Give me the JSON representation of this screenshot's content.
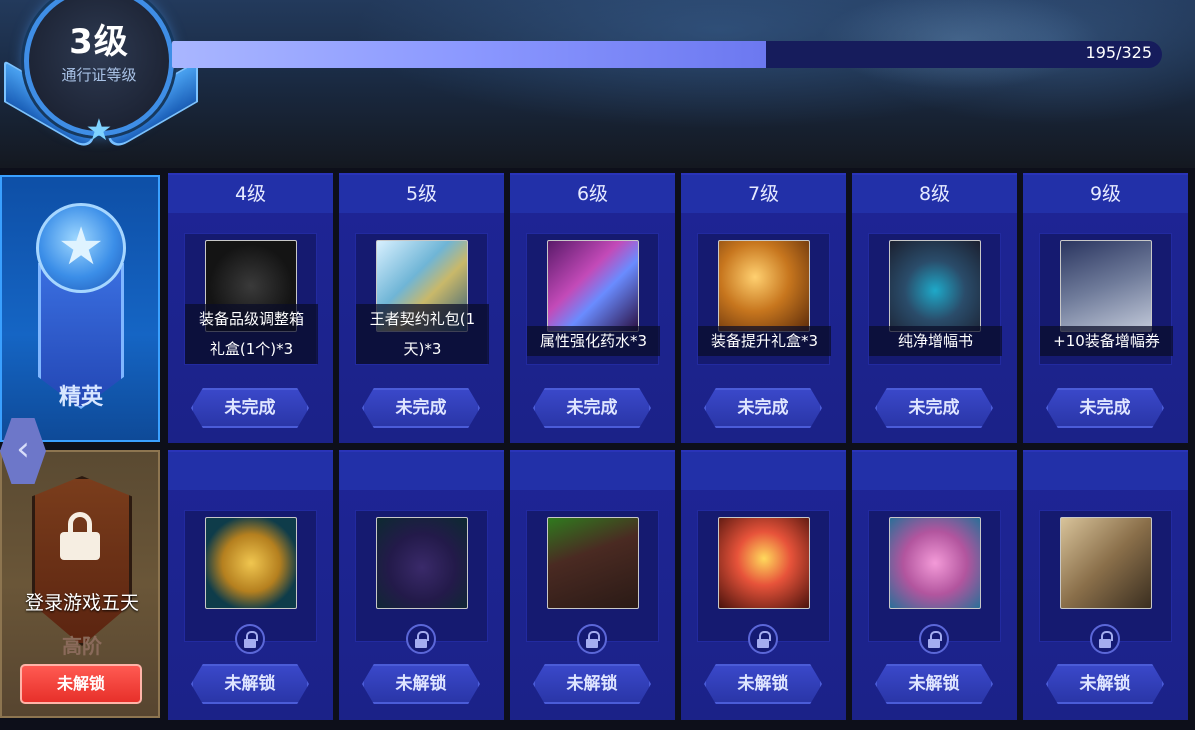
{
  "level": {
    "number": "3级",
    "caption": "通行证等级",
    "xp_text": "195/325",
    "xp_current": 195,
    "xp_total": 325
  },
  "tiers": {
    "elite": {
      "label": "精英"
    },
    "advanced": {
      "label": "高阶",
      "requirement": "登录游戏五天",
      "button": "未解锁"
    }
  },
  "columns": [
    {
      "level": "4级",
      "elite": {
        "name_lines": [
          "装备品级调整箱",
          "礼盒(1个)*3"
        ],
        "status": "未完成",
        "icon": "equipment-box-icon"
      },
      "advanced": {
        "status": "未解锁",
        "icon": "gold-coin-icon"
      }
    },
    {
      "level": "5级",
      "elite": {
        "name_lines": [
          "王者契约礼包(1",
          "天)*3"
        ],
        "status": "未完成",
        "icon": "contract-gift-icon"
      },
      "advanced": {
        "status": "未解锁",
        "icon": "potion-bottle-icon"
      }
    },
    {
      "level": "6级",
      "elite": {
        "name_lines": [
          "属性强化药水*3"
        ],
        "status": "未完成",
        "icon": "enhancement-potion-icon"
      },
      "advanced": {
        "status": "未解锁",
        "icon": "green-crystal-box-icon"
      }
    },
    {
      "level": "7级",
      "elite": {
        "name_lines": [
          "装备提升礼盒*3"
        ],
        "status": "未完成",
        "icon": "treasure-chest-icon"
      },
      "advanced": {
        "status": "未解锁",
        "icon": "fire-chest-icon"
      }
    },
    {
      "level": "8级",
      "elite": {
        "name_lines": [
          "纯净增幅书"
        ],
        "status": "未完成",
        "icon": "amplify-book-icon"
      },
      "advanced": {
        "status": "未解锁",
        "icon": "pink-chest-icon"
      }
    },
    {
      "level": "9级",
      "elite": {
        "name_lines": [
          "+10装备增幅券"
        ],
        "status": "未完成",
        "icon": "plus10-ticket-icon"
      },
      "advanced": {
        "status": "未解锁",
        "icon": "scroll-icon"
      }
    }
  ],
  "colors": {
    "xp_fill_start": "#a9b6ff",
    "xp_fill_end": "#6c78f0",
    "card_bg": "#1e2596",
    "unlock_button": "#ff5a52"
  }
}
